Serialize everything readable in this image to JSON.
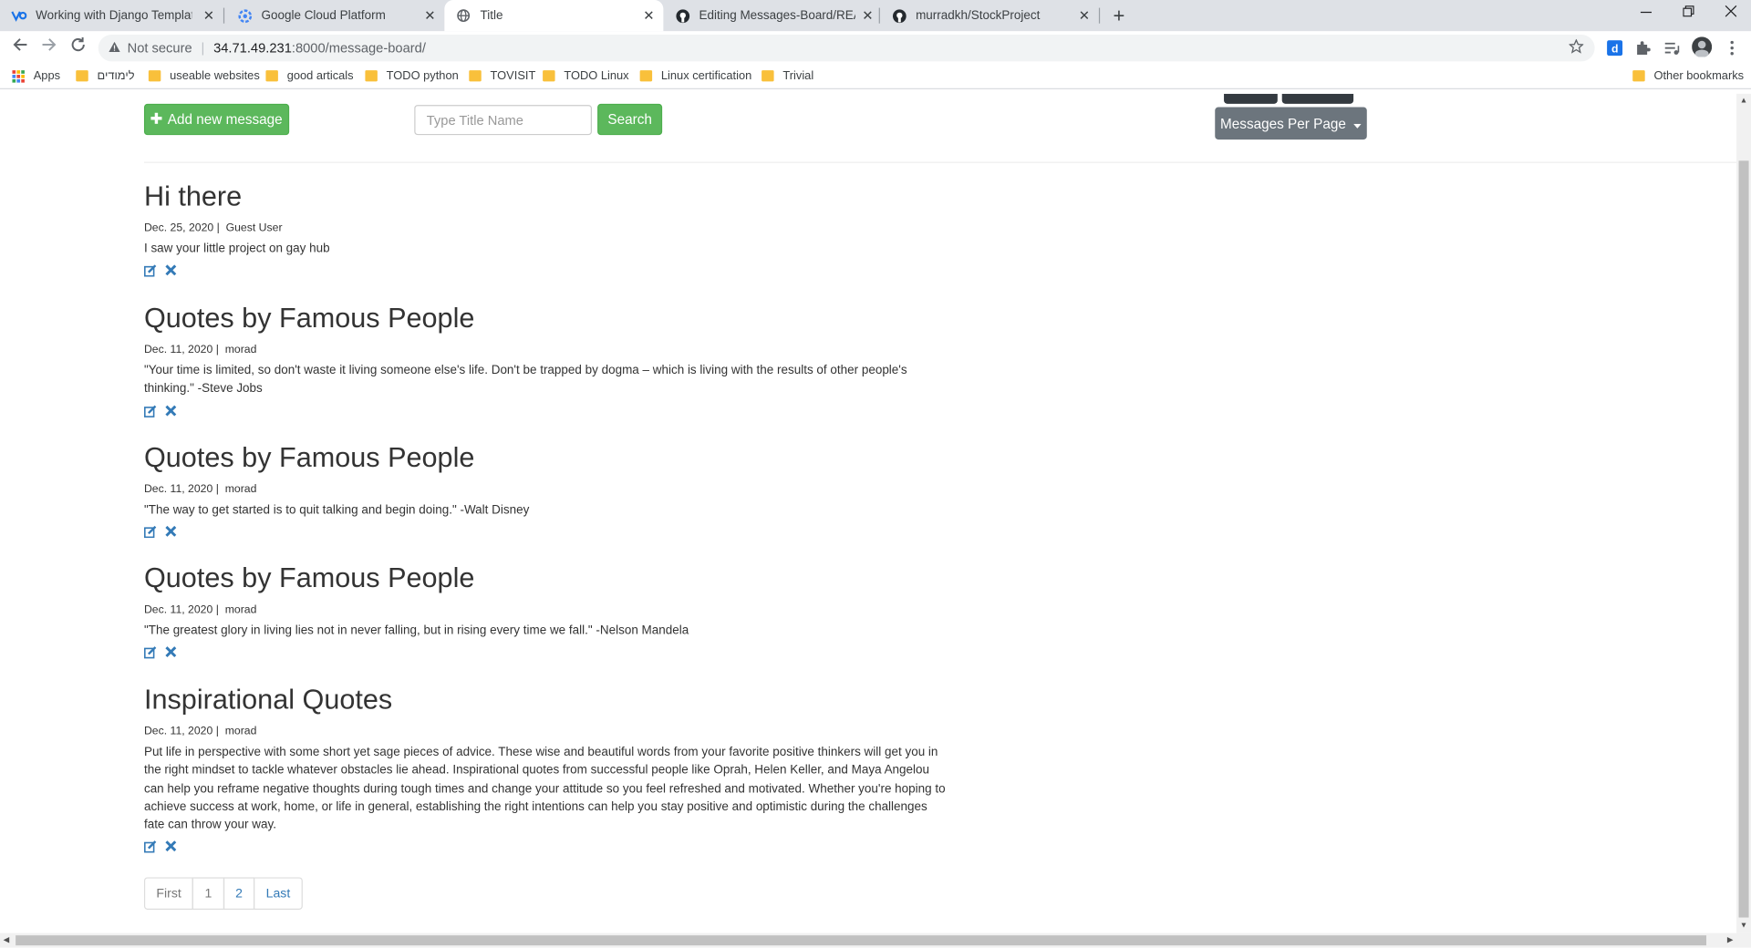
{
  "browser": {
    "tabs": [
      {
        "title": "Working with Django Templates &",
        "icon": "django-icon"
      },
      {
        "title": "Google Cloud Platform",
        "icon": "gcp-icon"
      },
      {
        "title": "Title",
        "icon": "globe-icon",
        "active": true
      },
      {
        "title": "Editing Messages-Board/READM",
        "icon": "github-icon"
      },
      {
        "title": "murradkh/StockProject",
        "icon": "github-icon"
      }
    ],
    "close_glyph": "✕",
    "newtab_glyph": "+",
    "omnibox": {
      "security": "Not secure",
      "host": "34.71.49.231",
      "path": ":8000/message-board/"
    },
    "bookmarks": [
      {
        "label": "Apps",
        "type": "apps"
      },
      {
        "label": "לימודים",
        "type": "folder"
      },
      {
        "label": "useable websites",
        "type": "folder"
      },
      {
        "label": "good articals",
        "type": "folder"
      },
      {
        "label": "TODO python",
        "type": "folder"
      },
      {
        "label": "TOVISIT",
        "type": "folder"
      },
      {
        "label": "TODO Linux",
        "type": "folder"
      },
      {
        "label": "Linux certification",
        "type": "folder"
      },
      {
        "label": "Trivial",
        "type": "folder"
      }
    ],
    "other_bookmarks": "Other bookmarks"
  },
  "page": {
    "add_button": "Add new message",
    "search_placeholder": "Type Title Name",
    "search_button": "Search",
    "per_page_button": "Messages Per Page",
    "messages": [
      {
        "title": "Hi there",
        "date": "Dec. 25, 2020",
        "author": "Guest User",
        "body": "I saw your little project on gay hub"
      },
      {
        "title": "Quotes by Famous People",
        "date": "Dec. 11, 2020",
        "author": "morad",
        "body": "\"Your time is limited, so don't waste it living someone else's life. Don't be trapped by dogma – which is living with the results of other people's thinking.\" -Steve Jobs"
      },
      {
        "title": "Quotes by Famous People",
        "date": "Dec. 11, 2020",
        "author": "morad",
        "body": "\"The way to get started is to quit talking and begin doing.\" -Walt Disney"
      },
      {
        "title": "Quotes by Famous People",
        "date": "Dec. 11, 2020",
        "author": "morad",
        "body": "\"The greatest glory in living lies not in never falling, but in rising every time we fall.\" -Nelson Mandela"
      },
      {
        "title": "Inspirational Quotes",
        "date": "Dec. 11, 2020",
        "author": "morad",
        "body": "Put life in perspective with some short yet sage pieces of advice. These wise and beautiful words from your favorite positive thinkers will get you in the right mindset to tackle whatever obstacles lie ahead. Inspirational quotes from successful people like Oprah, Helen Keller, and Maya Angelou can help you reframe negative thoughts during tough times and change your attitude so you feel refreshed and motivated. Whether you're hoping to achieve success at work, home, or life in general, establishing the right intentions can help you stay positive and optimistic during the challenges fate can throw your way."
      }
    ],
    "pagination": {
      "first": "First",
      "p1": "1",
      "p2": "2",
      "last": "Last"
    }
  },
  "colors": {
    "success": "#5cb85c",
    "link": "#337ab7",
    "secondary": "#6c757d"
  }
}
